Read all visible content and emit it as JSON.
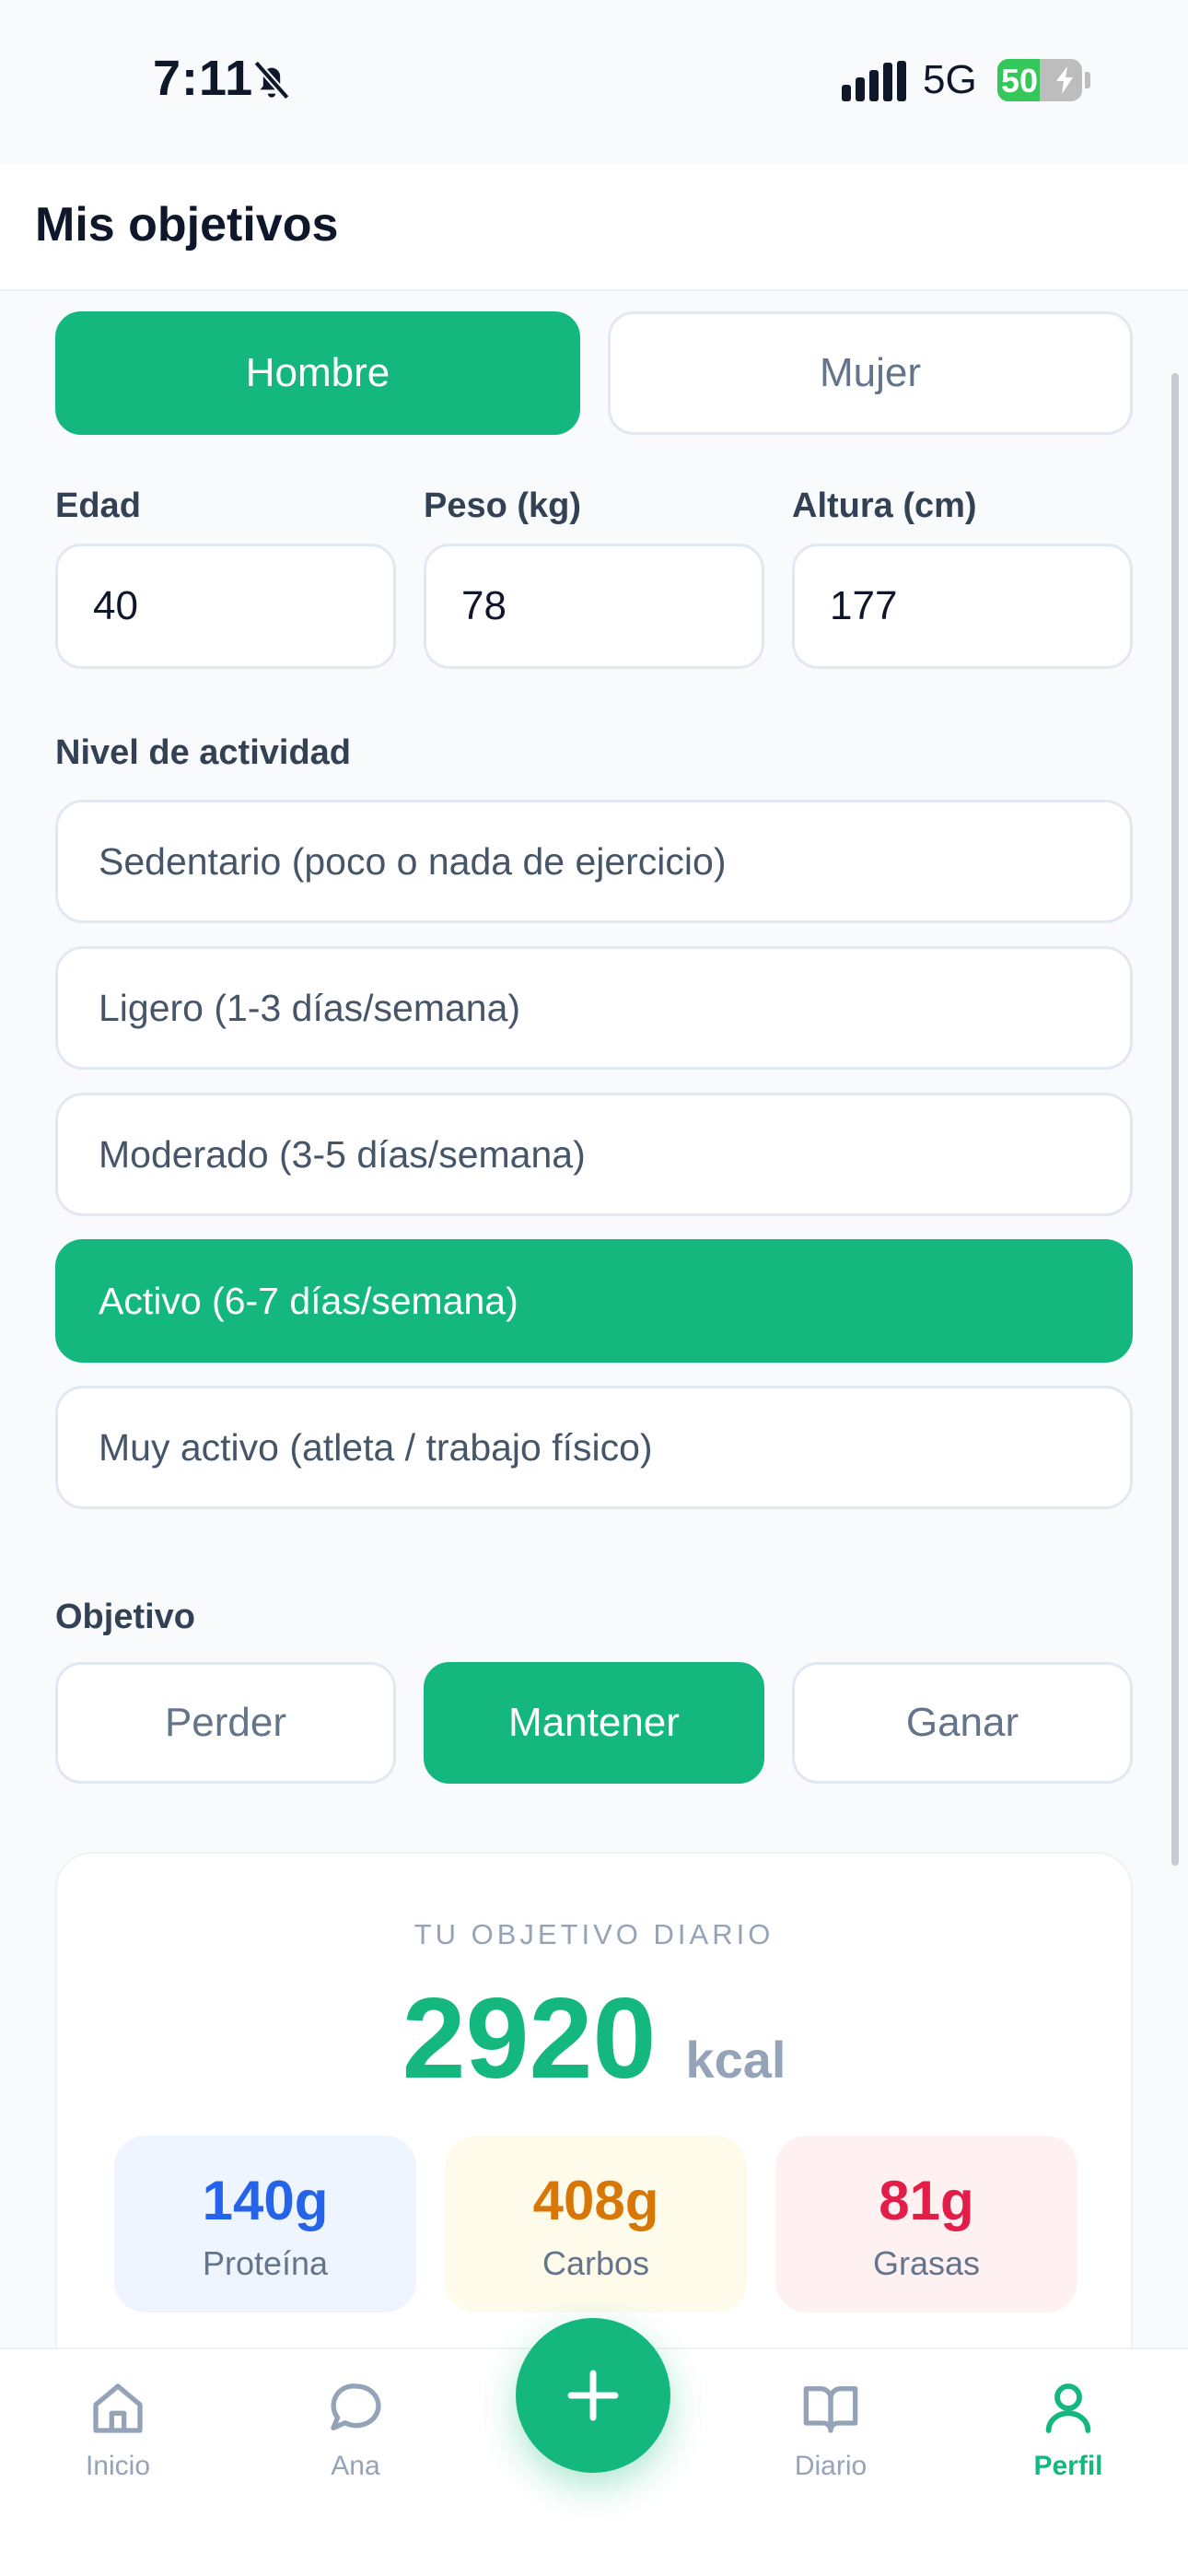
{
  "status_bar": {
    "time": "7:11",
    "network": "5G",
    "battery": "50",
    "battery_level": 0.5
  },
  "header": {
    "title": "Mis objetivos"
  },
  "gender": {
    "options": [
      {
        "label": "Hombre",
        "selected": true
      },
      {
        "label": "Mujer",
        "selected": false
      }
    ]
  },
  "fields": {
    "age": {
      "label": "Edad",
      "value": "40"
    },
    "weight": {
      "label": "Peso (kg)",
      "value": "78"
    },
    "height": {
      "label": "Altura (cm)",
      "value": "177"
    }
  },
  "activity": {
    "label": "Nivel de actividad",
    "options": [
      {
        "label": "Sedentario (poco o nada de ejercicio)",
        "selected": false
      },
      {
        "label": "Ligero (1-3 días/semana)",
        "selected": false
      },
      {
        "label": "Moderado (3-5 días/semana)",
        "selected": false
      },
      {
        "label": "Activo (6-7 días/semana)",
        "selected": true
      },
      {
        "label": "Muy activo (atleta / trabajo físico)",
        "selected": false
      }
    ]
  },
  "goal": {
    "label": "Objetivo",
    "options": [
      {
        "label": "Perder",
        "selected": false
      },
      {
        "label": "Mantener",
        "selected": true
      },
      {
        "label": "Ganar",
        "selected": false
      }
    ]
  },
  "summary": {
    "caption": "TU OBJETIVO DIARIO",
    "kcal_value": "2920",
    "kcal_unit": "kcal",
    "macros": [
      {
        "value": "140g",
        "label": "Proteína",
        "color": "#2563eb",
        "bg": "#eef5fe"
      },
      {
        "value": "408g",
        "label": "Carbos",
        "color": "#d97706",
        "bg": "#fefbea"
      },
      {
        "value": "81g",
        "label": "Grasas",
        "color": "#e11d48",
        "bg": "#fff1f1"
      }
    ]
  },
  "nav": {
    "items": [
      {
        "label": "Inicio",
        "icon": "home-icon",
        "active": false
      },
      {
        "label": "Ana",
        "icon": "chat-icon",
        "active": false
      },
      {
        "label": "Diario",
        "icon": "book-icon",
        "active": false
      },
      {
        "label": "Perfil",
        "icon": "user-icon",
        "active": true
      }
    ],
    "fab_icon": "plus-icon"
  },
  "colors": {
    "accent": "#14b87e",
    "text_muted": "#64748b",
    "border": "#e2e8f0"
  }
}
